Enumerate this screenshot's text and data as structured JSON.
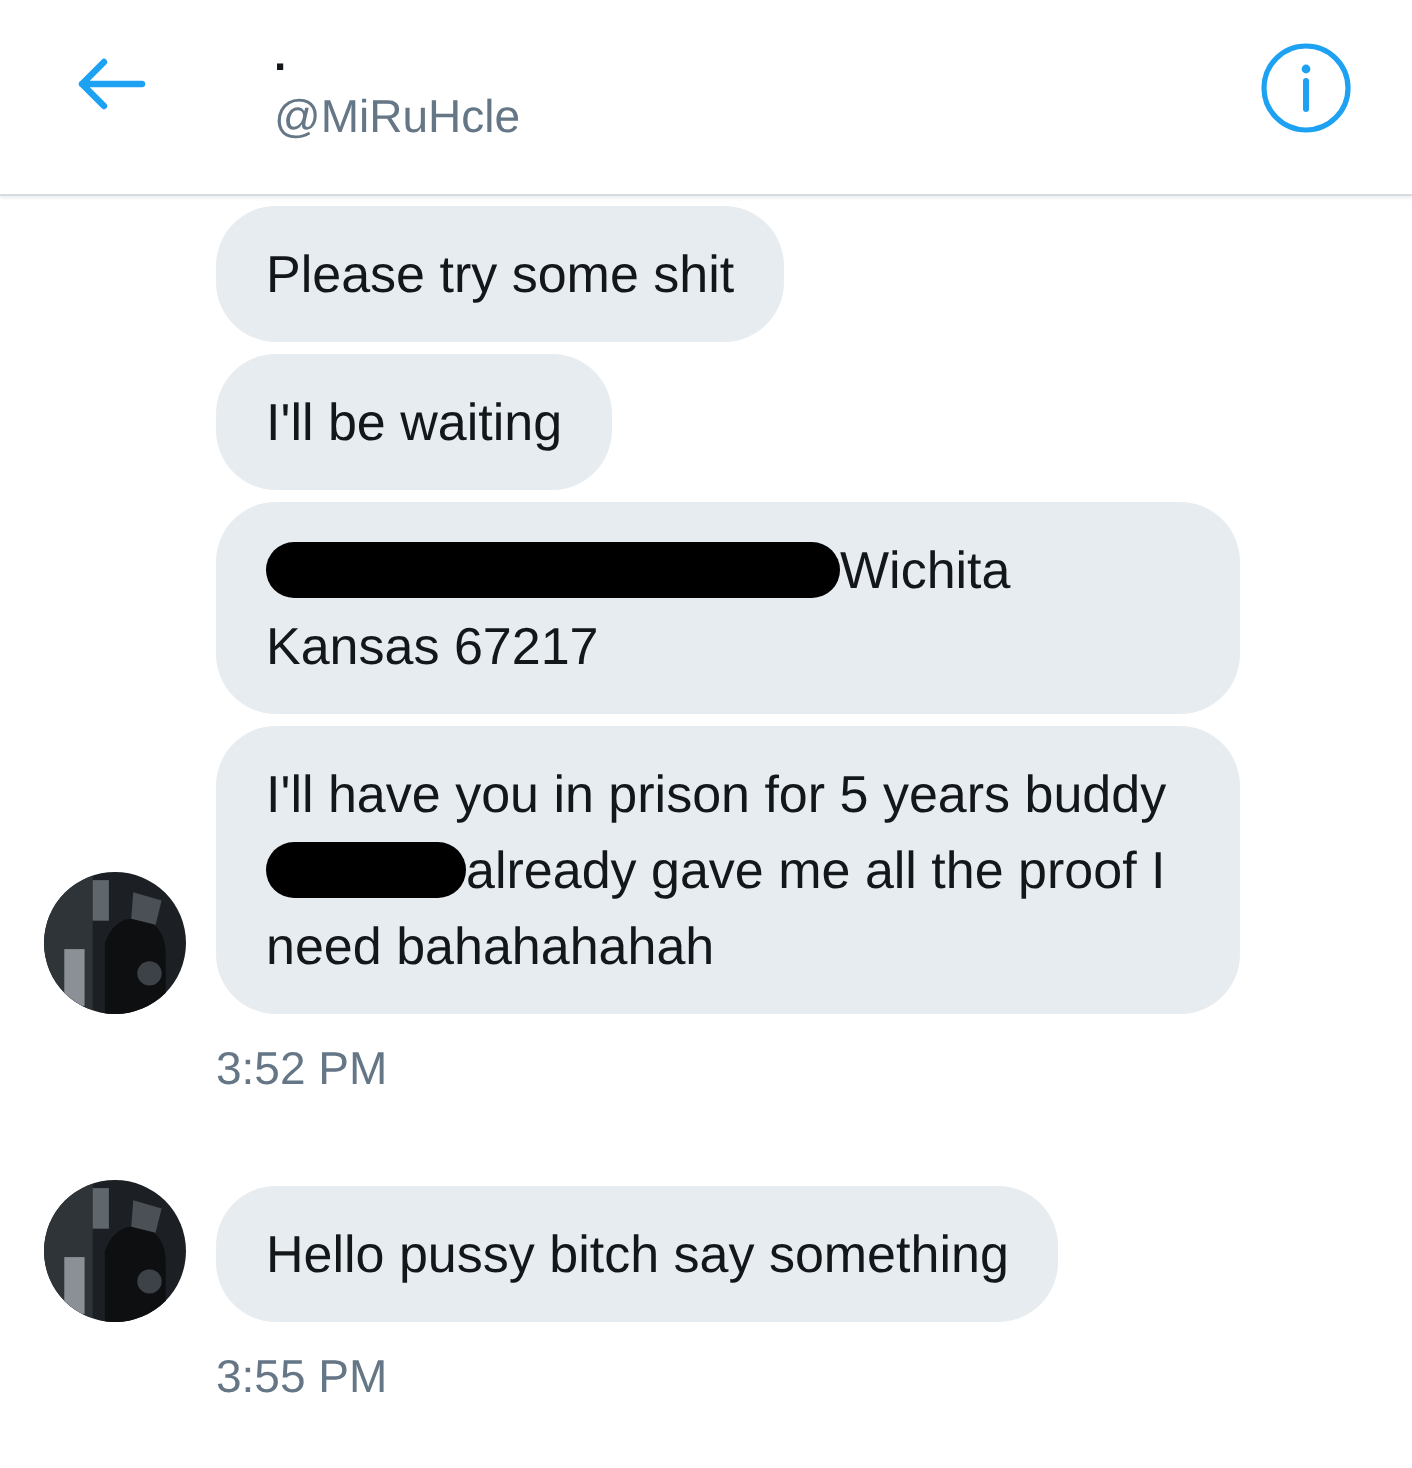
{
  "header": {
    "name": ".",
    "handle": "@MiRuHcle"
  },
  "groups": [
    {
      "avatar": {
        "kind": "picture"
      },
      "time": "3:52 PM",
      "messages": [
        {
          "parts": [
            {
              "kind": "text",
              "text": "Please try some shit"
            }
          ]
        },
        {
          "parts": [
            {
              "kind": "text",
              "text": "I'll be waiting"
            }
          ]
        },
        {
          "parts": [
            {
              "kind": "redacted_long"
            },
            {
              "kind": "text",
              "text": "Wichita Kansas 67217"
            }
          ]
        },
        {
          "parts": [
            {
              "kind": "text",
              "text": "I'll have you in prison for 5 years buddy"
            },
            {
              "kind": "redacted_short"
            },
            {
              "kind": "text",
              "text": "already gave me all the proof I need bahahahahah"
            }
          ]
        }
      ]
    },
    {
      "avatar": {
        "kind": "picture"
      },
      "time": "3:55 PM",
      "messages": [
        {
          "parts": [
            {
              "kind": "text",
              "text": "Hello pussy bitch say something"
            }
          ]
        }
      ]
    }
  ]
}
